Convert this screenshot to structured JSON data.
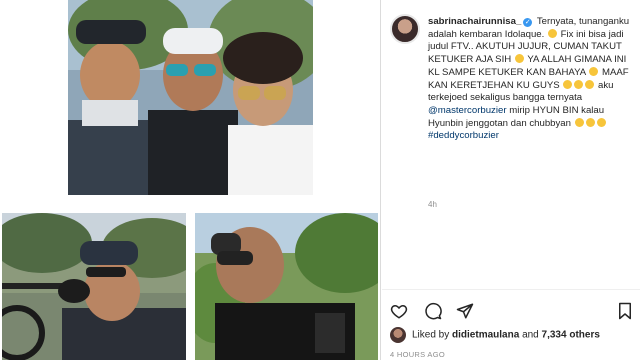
{
  "post": {
    "username": "sabrinachairunnisa_",
    "caption_text_1": "Ternyata, tunanganku adalah kembaran Idolaque.",
    "caption_text_2": "Fix ini bisa jadi judul FTV.. AKUTUH JUJUR, CUMAN TAKUT KETUKER AJA SIH",
    "caption_text_3": "YA ALLAH GIMANA INI KL SAMPE KETUKER KAN BAHAYA",
    "caption_text_4": "MAAF KAN KERETJEHAN KU GUYS",
    "caption_text_5": "aku terkejoed sekaligus bangga ternyata",
    "mention": "@mastercorbuzier",
    "caption_text_6": "mirip HYUN BIN kalau Hyunbin jenggotan dan chubbyan",
    "hashtag": "#deddycorbuzier",
    "time": "4h"
  },
  "likes": {
    "prefix": "Liked by",
    "liker": "didietmaulana",
    "joiner": "and",
    "others": "7,334 others"
  },
  "timestamp": "4 HOURS AGO",
  "icons": {
    "like": "heart-icon",
    "comment": "comment-icon",
    "share": "share-icon",
    "save": "bookmark-icon",
    "verified": "verified-badge-icon"
  },
  "colors": {
    "link": "#00376b",
    "verified": "#3897f0",
    "muted": "#8e8e8e"
  }
}
